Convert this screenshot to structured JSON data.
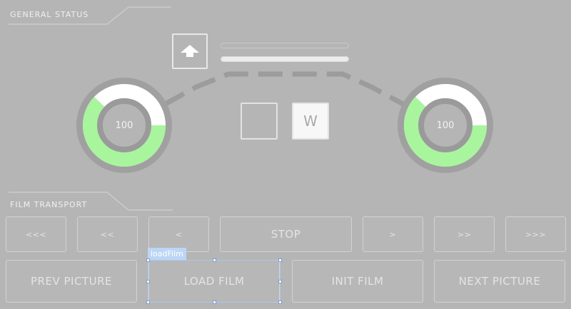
{
  "general_status": {
    "title": "GENERAL STATUS",
    "gauge_left": {
      "value": "100",
      "green_fraction": 0.62
    },
    "gauge_right": {
      "value": "100",
      "green_fraction": 0.62
    },
    "eject_icon": "eject-up-arrow-icon",
    "progress_top": 0.0,
    "progress_bottom": 1.0,
    "toggle_left": {
      "label": ""
    },
    "toggle_right": {
      "label": "W"
    }
  },
  "film_transport": {
    "title": "FILM TRANSPORT",
    "speed_buttons": [
      "<<<",
      "<<",
      "<",
      "STOP",
      ">",
      ">>",
      ">>>"
    ],
    "action_buttons": [
      "PREV PICTURE",
      "LOAD FILM",
      "INIT FILM",
      "NEXT PICTURE"
    ]
  },
  "selection": {
    "tag_label": "loadFilm"
  },
  "colors": {
    "background": "#b5b5b5",
    "gauge_green": "#a8f59e",
    "gauge_white": "#ffffff",
    "gauge_ring": "#9a9a9a",
    "selection_blue": "#bcd6f5"
  }
}
